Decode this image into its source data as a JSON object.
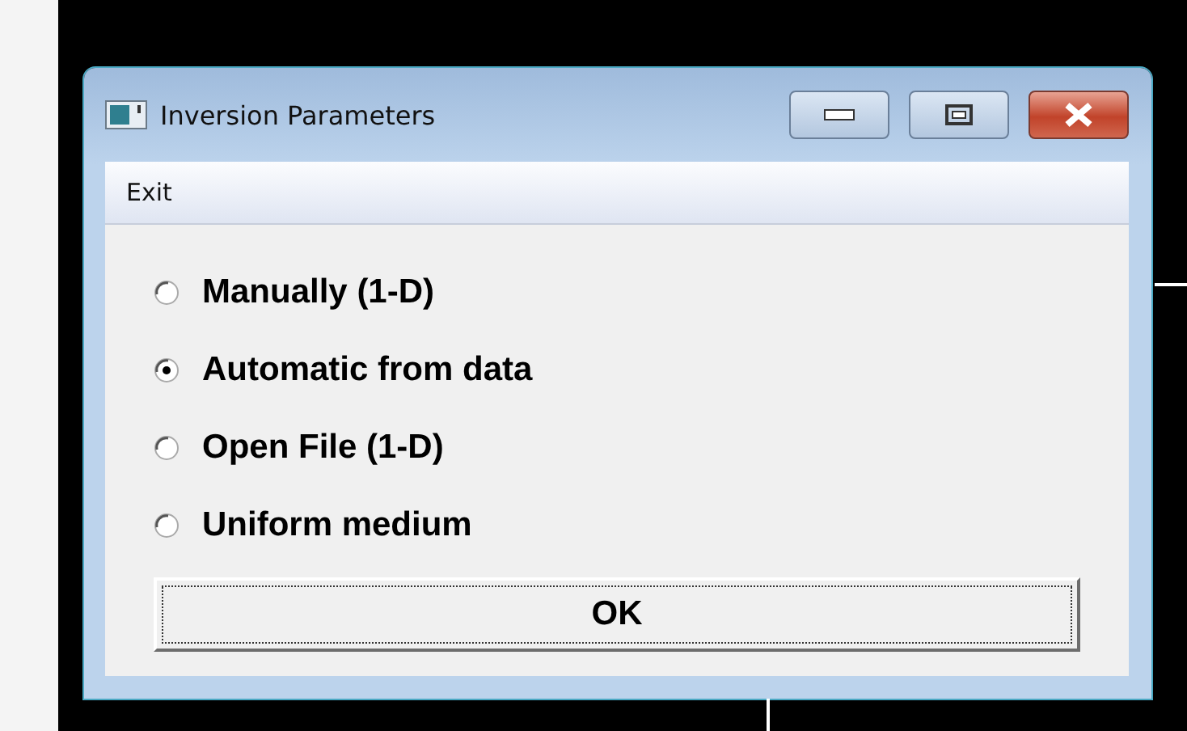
{
  "window": {
    "title": "Inversion Parameters"
  },
  "menu": [
    {
      "label": "Exit"
    }
  ],
  "options": [
    {
      "label": "Manually (1-D)",
      "selected": false
    },
    {
      "label": "Automatic from data",
      "selected": true
    },
    {
      "label": "Open File (1-D)",
      "selected": false
    },
    {
      "label": "Uniform medium",
      "selected": false
    }
  ],
  "buttons": [
    {
      "label": "OK"
    }
  ]
}
